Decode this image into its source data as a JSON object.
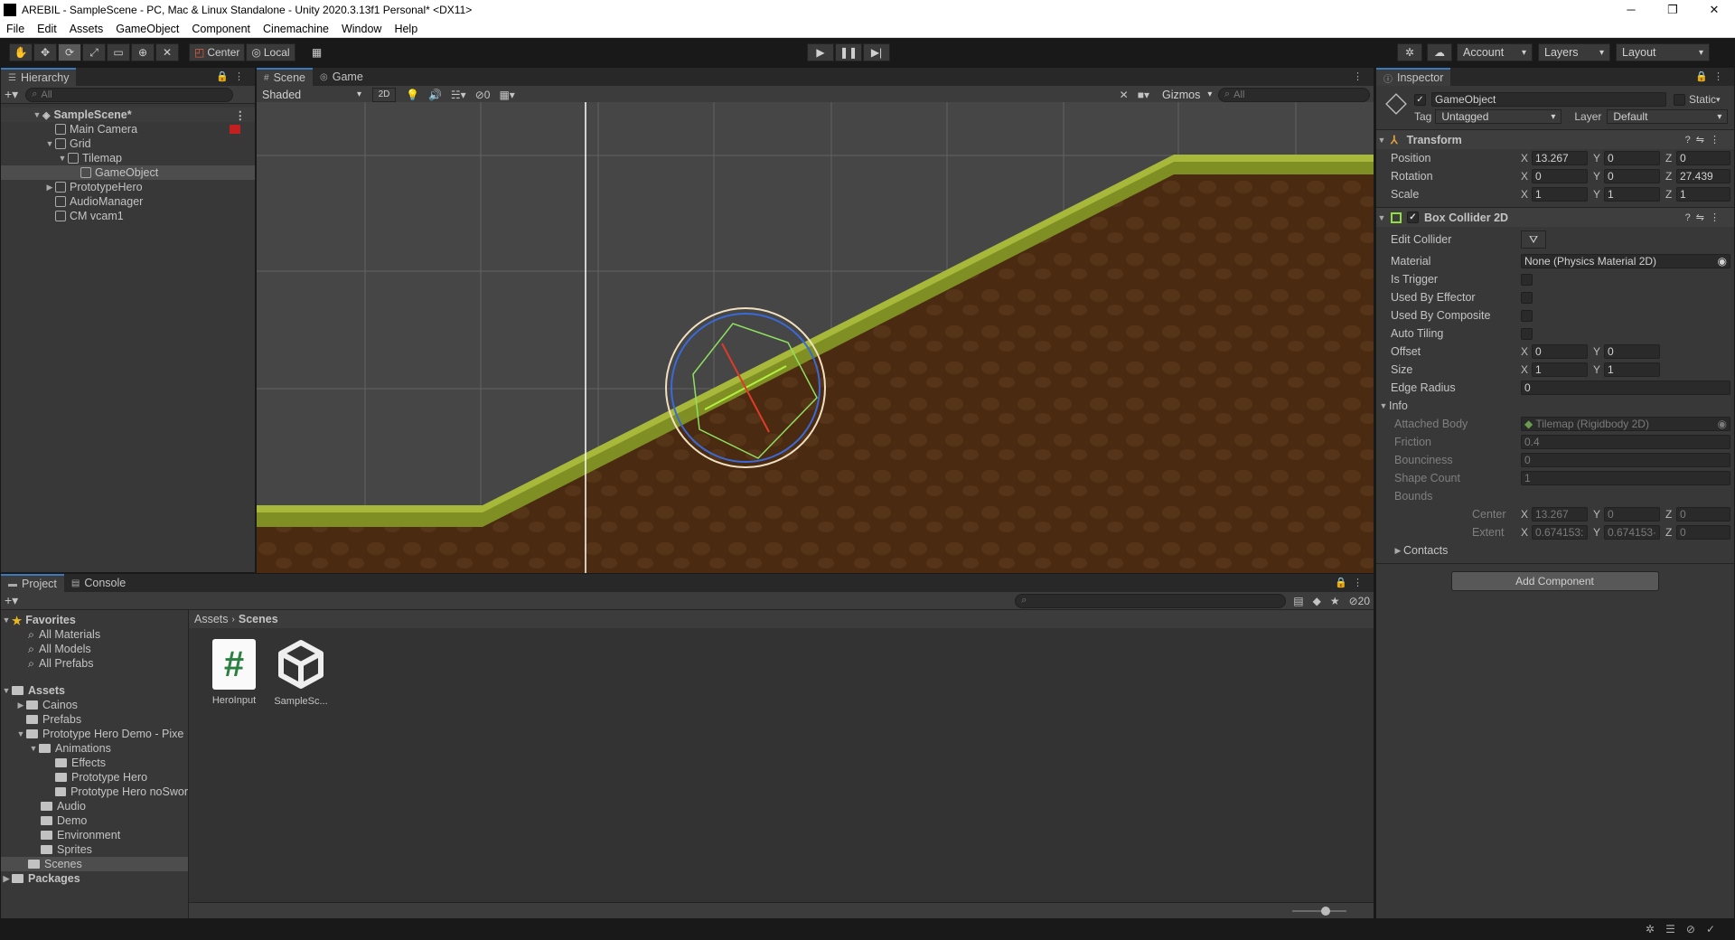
{
  "window": {
    "title": "AREBIL - SampleScene - PC, Mac & Linux Standalone - Unity 2020.3.13f1 Personal* <DX11>",
    "controls": [
      "─",
      "❐",
      "✕"
    ]
  },
  "menu": [
    "File",
    "Edit",
    "Assets",
    "GameObject",
    "Component",
    "Cinemachine",
    "Window",
    "Help"
  ],
  "toolbar": {
    "pivot": "Center",
    "space": "Local",
    "account": "Account",
    "layers": "Layers",
    "layout": "Layout"
  },
  "hierarchy": {
    "tab": "Hierarchy",
    "search_placeholder": "All",
    "items": [
      {
        "label": "SampleScene*",
        "indent": 0
      },
      {
        "label": "Main Camera",
        "indent": 1
      },
      {
        "label": "Grid",
        "indent": 1
      },
      {
        "label": "Tilemap",
        "indent": 2
      },
      {
        "label": "GameObject",
        "indent": 3
      },
      {
        "label": "PrototypeHero",
        "indent": 1
      },
      {
        "label": "AudioManager",
        "indent": 1
      },
      {
        "label": "CM vcam1",
        "indent": 1
      }
    ]
  },
  "scene": {
    "tabs": [
      "Scene",
      "Game"
    ],
    "shading": "Shaded",
    "mode_2d": "2D",
    "hidden_count": "0",
    "gizmos": "Gizmos",
    "search_placeholder": "All"
  },
  "inspector": {
    "tab": "Inspector",
    "object_name": "GameObject",
    "static_label": "Static",
    "tag_label": "Tag",
    "tag_value": "Untagged",
    "layer_label": "Layer",
    "layer_value": "Default",
    "transform": {
      "title": "Transform",
      "position_label": "Position",
      "position": {
        "x": "13.267",
        "y": "0",
        "z": "0"
      },
      "rotation_label": "Rotation",
      "rotation": {
        "x": "0",
        "y": "0",
        "z": "27.439"
      },
      "scale_label": "Scale",
      "scale": {
        "x": "1",
        "y": "1",
        "z": "1"
      }
    },
    "collider": {
      "title": "Box Collider 2D",
      "edit_collider": "Edit Collider",
      "material_label": "Material",
      "material_value": "None (Physics Material 2D)",
      "is_trigger": "Is Trigger",
      "used_by_effector": "Used By Effector",
      "used_by_composite": "Used By Composite",
      "auto_tiling": "Auto Tiling",
      "offset_label": "Offset",
      "offset": {
        "x": "0",
        "y": "0"
      },
      "size_label": "Size",
      "size": {
        "x": "1",
        "y": "1"
      },
      "edge_radius_label": "Edge Radius",
      "edge_radius": "0",
      "info_label": "Info",
      "attached_body_label": "Attached Body",
      "attached_body": "Tilemap (Rigidbody 2D)",
      "friction_label": "Friction",
      "friction": "0.4",
      "bounciness_label": "Bounciness",
      "bounciness": "0",
      "shape_count_label": "Shape Count",
      "shape_count": "1",
      "bounds_label": "Bounds",
      "center_label": "Center",
      "center": {
        "x": "13.267",
        "y": "0",
        "z": "0"
      },
      "extent_label": "Extent",
      "extent": {
        "x": "0.674153:",
        "y": "0.674153·",
        "z": "0"
      },
      "contacts_label": "Contacts"
    },
    "add_component": "Add Component"
  },
  "project": {
    "tabs": [
      "Project",
      "Console"
    ],
    "hidden_count": "20",
    "breadcrumb": [
      "Assets",
      "Scenes"
    ],
    "favorites_label": "Favorites",
    "favorites": [
      "All Materials",
      "All Models",
      "All Prefabs"
    ],
    "assets_label": "Assets",
    "tree": [
      {
        "label": "Cainos",
        "indent": 1,
        "arrow": "▶"
      },
      {
        "label": "Prefabs",
        "indent": 1,
        "arrow": ""
      },
      {
        "label": "Prototype Hero Demo - Pixe",
        "indent": 1,
        "arrow": "▼"
      },
      {
        "label": "Animations",
        "indent": 2,
        "arrow": "▼"
      },
      {
        "label": "Effects",
        "indent": 3,
        "arrow": ""
      },
      {
        "label": "Prototype Hero",
        "indent": 3,
        "arrow": ""
      },
      {
        "label": "Prototype Hero noSwor",
        "indent": 3,
        "arrow": ""
      },
      {
        "label": "Audio",
        "indent": 2,
        "arrow": ""
      },
      {
        "label": "Demo",
        "indent": 2,
        "arrow": ""
      },
      {
        "label": "Environment",
        "indent": 2,
        "arrow": ""
      },
      {
        "label": "Sprites",
        "indent": 2,
        "arrow": ""
      },
      {
        "label": "Scenes",
        "indent": 1,
        "arrow": ""
      }
    ],
    "packages_label": "Packages",
    "files": [
      {
        "label": "HeroInput",
        "icon": "csharp-script-icon",
        "glyph": "#"
      },
      {
        "label": "SampleSc...",
        "icon": "unity-scene-icon",
        "glyph": ""
      }
    ]
  },
  "colors": {
    "accent": "#3a79bb",
    "selection": "#4d4d4d",
    "grass": "#8a9a2a",
    "dirt": "#4a2b12"
  }
}
